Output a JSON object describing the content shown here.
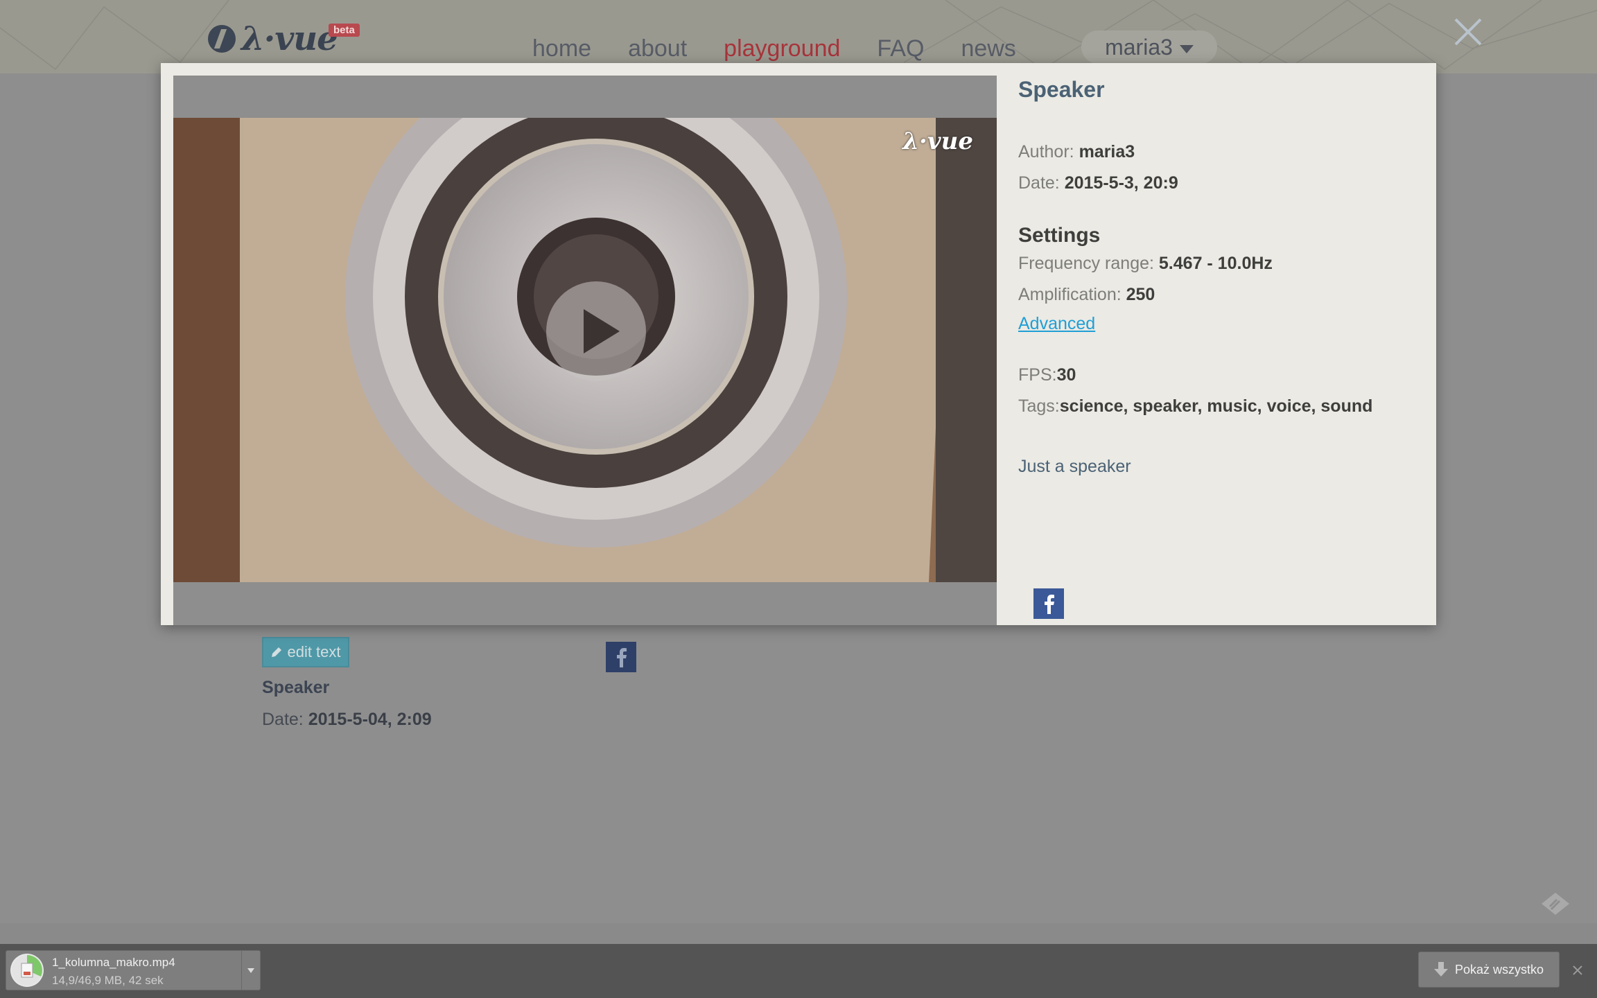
{
  "header": {
    "logo_text": "λ·vue",
    "beta_badge": "beta",
    "nav": [
      {
        "label": "home",
        "active": false
      },
      {
        "label": "about",
        "active": false
      },
      {
        "label": "playground",
        "active": true
      },
      {
        "label": "FAQ",
        "active": false
      },
      {
        "label": "news",
        "active": false
      }
    ],
    "user": "maria3",
    "close_icon": "close-icon"
  },
  "page": {
    "edit_button": "edit text",
    "title": "Speaker",
    "date_label": "Date:",
    "date_value": "2015-5-04, 2:09"
  },
  "modal": {
    "video": {
      "watermark": "λ·vue",
      "play_icon": "play-icon"
    },
    "title": "Speaker",
    "author_label": "Author:",
    "author_value": "maria3",
    "date_label": "Date:",
    "date_value": "2015-5-3, 20:9",
    "settings_heading": "Settings",
    "frequency_label": "Frequency range:",
    "frequency_value": "5.467 - 10.0Hz",
    "amplification_label": "Amplification:",
    "amplification_value": "250",
    "advanced_link": "Advanced",
    "fps_label": "FPS:",
    "fps_value": "30",
    "tags_label": "Tags:",
    "tags_value": "science, speaker, music, voice, sound",
    "description": "Just a speaker"
  },
  "downloads": {
    "file_name": "1_kolumna_makro.mp4",
    "progress": "14,9/46,9 MB, 42 sek",
    "show_all": "Pokaż wszystko"
  },
  "colors": {
    "accent_active_nav": "#a8343b",
    "link": "#1f9fd6",
    "facebook": "#3b5998",
    "edit_button": "#4f98a7"
  }
}
